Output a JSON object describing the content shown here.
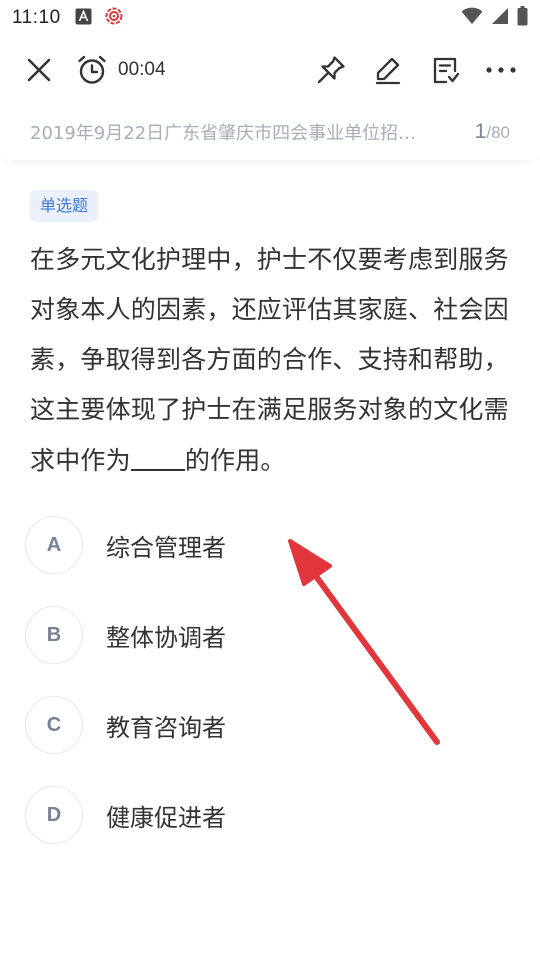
{
  "status_bar": {
    "time": "11:10",
    "icons": [
      "font-a-icon",
      "target-icon",
      "wifi-icon",
      "signal-icon",
      "battery-icon"
    ]
  },
  "toolbar": {
    "timer": "00:04",
    "icons": [
      "close-icon",
      "alarm-clock-icon",
      "pin-icon",
      "edit-icon",
      "note-icon",
      "more-icon"
    ]
  },
  "exam": {
    "title": "2019年9月22日广东省肇庆市四会事业单位招…",
    "current": "1",
    "separator": "/",
    "total": "80"
  },
  "question": {
    "type_label": "单选题",
    "stem_part1": "在多元文化护理中，护士不仅要考虑到服务对象本人的因素，还应评估其家庭、社会因素，争取得到各方面的合作、支持和帮助，这主要体现了护士在满足服务对象的文化需求中作为",
    "stem_part2": "的作用。",
    "options": [
      {
        "letter": "A",
        "text": "综合管理者"
      },
      {
        "letter": "B",
        "text": "整体协调者"
      },
      {
        "letter": "C",
        "text": "教育咨询者"
      },
      {
        "letter": "D",
        "text": "健康促进者"
      }
    ]
  },
  "colors": {
    "accent_blue": "#3f77d8",
    "tag_bg": "#eaf1fd",
    "arrow_red": "#e0363c",
    "muted_text": "#a8adb8"
  }
}
